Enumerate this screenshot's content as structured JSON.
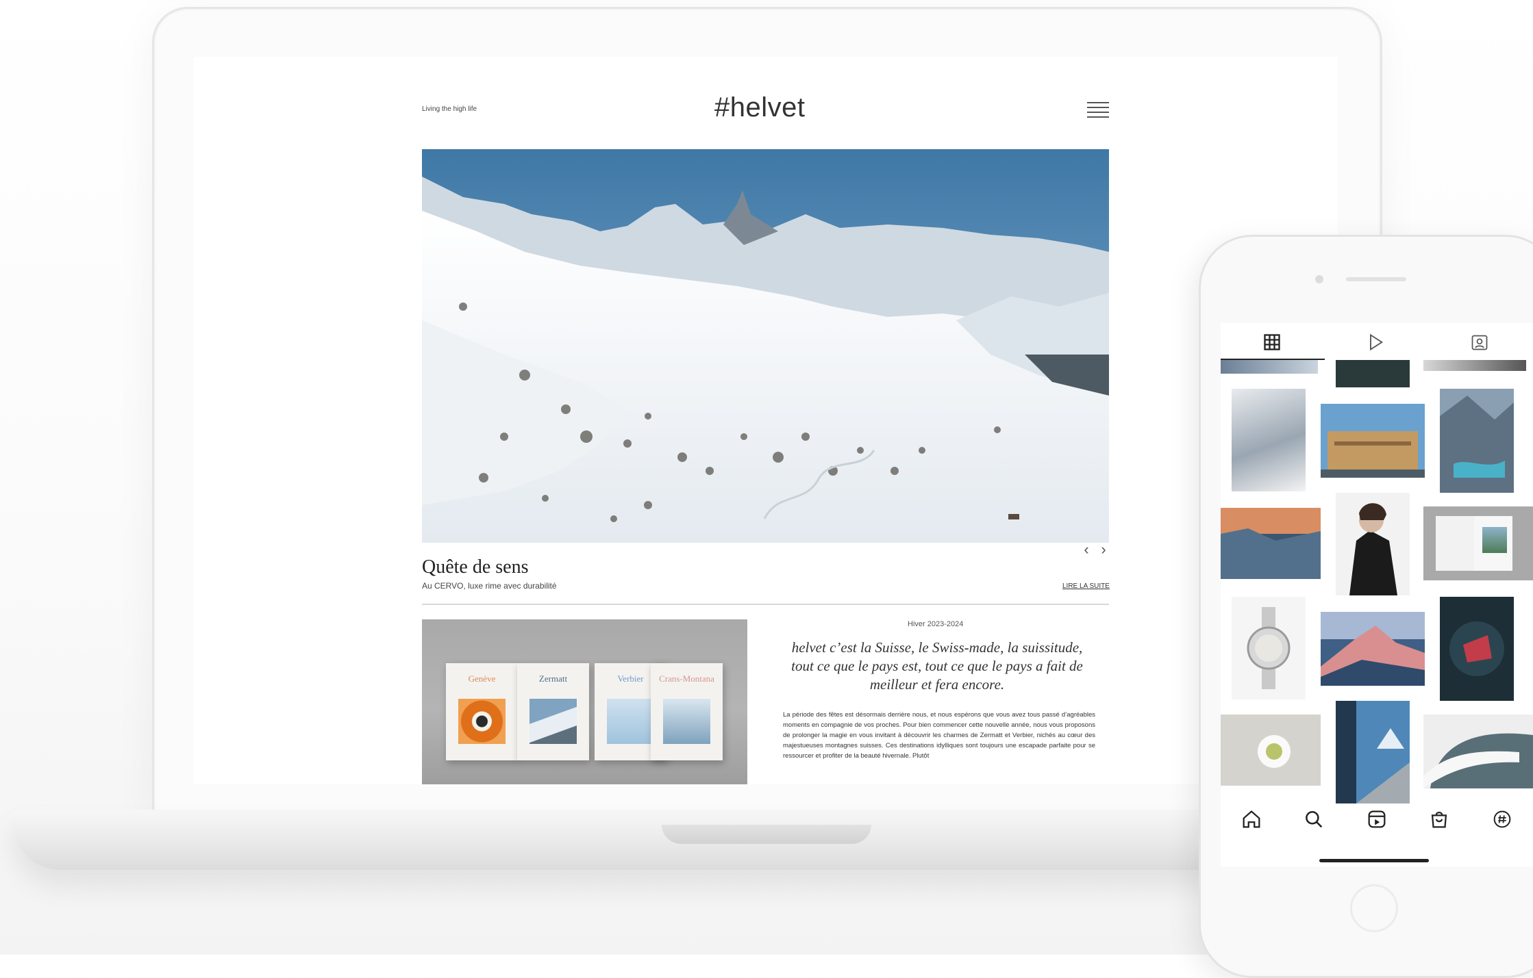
{
  "site": {
    "tagline": "Living the high life",
    "logo": "#helvet",
    "slider_prev": "‹",
    "slider_next": "›",
    "article": {
      "title": "Quête de sens",
      "subtitle": "Au CERVO, luxe rime avec durabilité",
      "read_more": "LIRE LA SUITE"
    },
    "magazines": [
      "Genève",
      "Zermatt",
      "Verbier",
      "Crans-Montana"
    ],
    "season": "Hiver 2023-2024",
    "lead": "helvet c’est la Suisse, le Swiss-made, la suissitude, tout ce que le pays est, tout ce que le pays a fait de meilleur et fera encore.",
    "body": "La période des fêtes est désormais derrière nous, et nous espérons que vous avez tous passé d’agréables moments en compagnie de vos proches. Pour bien commencer cette nouvelle année, nous vous proposons de prolonger la magie en vous invitant à découvrir les charmes de Zermatt et Verbier, nichés au cœur des majestueuses montagnes suisses. Ces destinations idylliques sont toujours une escapade parfaite pour se ressourcer et profiter de la beauté hivernale. Plutôt"
  },
  "phone": {
    "tabs": [
      "grid-icon",
      "reels-play-icon",
      "tagged-icon"
    ],
    "active_tab": 0,
    "bottom_nav": [
      "home-icon",
      "search-icon",
      "reels-icon",
      "shop-icon",
      "profile-icon"
    ]
  },
  "colors": {
    "sky": "#4a7ea8",
    "snow": "#f2f4f6",
    "accent_dark": "#222222"
  }
}
